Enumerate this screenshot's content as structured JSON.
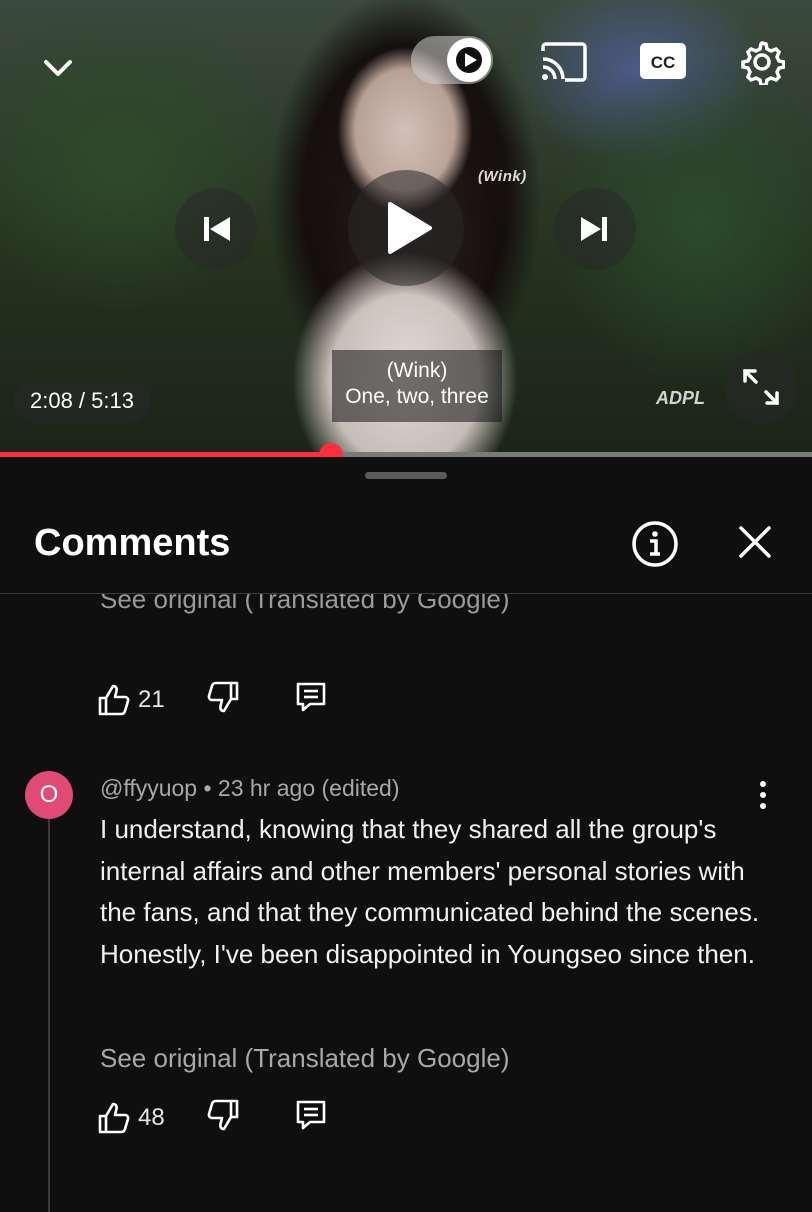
{
  "player": {
    "current_time": "2:08",
    "duration": "5:13",
    "time_display": "2:08 / 5:13",
    "watermark_tag": "(Wink)",
    "subtitle_line1": "(Wink)",
    "subtitle_line2": "One, two, three",
    "channel_watermark": "ADPL",
    "progress_fraction": 0.408,
    "accent_color": "#ff2e3d",
    "icons": [
      "chevron-down-icon",
      "autoplay-toggle-icon",
      "cast-icon",
      "cc-icon",
      "settings-gear-icon",
      "previous-icon",
      "play-icon",
      "next-icon",
      "fullscreen-icon"
    ]
  },
  "comments_panel": {
    "title": "Comments",
    "top_partial": {
      "see_original": "See original (Translated by Google)",
      "likes": "21"
    },
    "comment": {
      "avatar_letter": "O",
      "avatar_color": "#e04a74",
      "author": "@ffyyuop",
      "time": "23 hr ago (edited)",
      "meta": "@ffyyuop • 23 hr ago (edited)",
      "text": "I understand, knowing that they shared all the group's internal affairs and other members' personal stories with the fans, and that they communicated behind the scenes. Honestly, I've been disappointed in Youngseo since then.",
      "see_original": "See original (Translated by Google)",
      "likes": "48"
    }
  }
}
